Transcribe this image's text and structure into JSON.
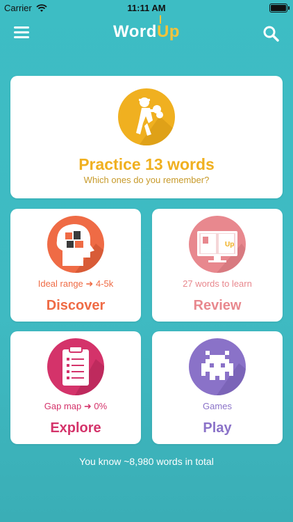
{
  "status_bar": {
    "carrier": "Carrier",
    "time": "11:11 AM"
  },
  "nav": {
    "logo_word": "Word",
    "logo_up": "Up"
  },
  "practice": {
    "title": "Practice 13 words",
    "subtitle": "Which ones do you remember?"
  },
  "cards": {
    "discover": {
      "caption": "Ideal range",
      "range": "4-5k",
      "label": "Discover"
    },
    "review": {
      "caption": "27 words to learn",
      "label": "Review"
    },
    "explore": {
      "caption": "Gap map",
      "value": "0%",
      "label": "Explore"
    },
    "play": {
      "caption": "Games",
      "label": "Play"
    }
  },
  "footer": {
    "text": "You know ~8,980 words in total"
  },
  "colors": {
    "background": "#3dbdc4",
    "practice": "#f0b020",
    "discover": "#ef6b45",
    "review": "#e8888e",
    "explore": "#d4336a",
    "play": "#8a72c8"
  },
  "icons": {
    "menu": "hamburger-icon",
    "search": "search-icon",
    "practice": "boxer-icon",
    "discover": "head-puzzle-icon",
    "review": "monitor-book-icon",
    "explore": "clipboard-icon",
    "play": "space-invader-icon"
  }
}
